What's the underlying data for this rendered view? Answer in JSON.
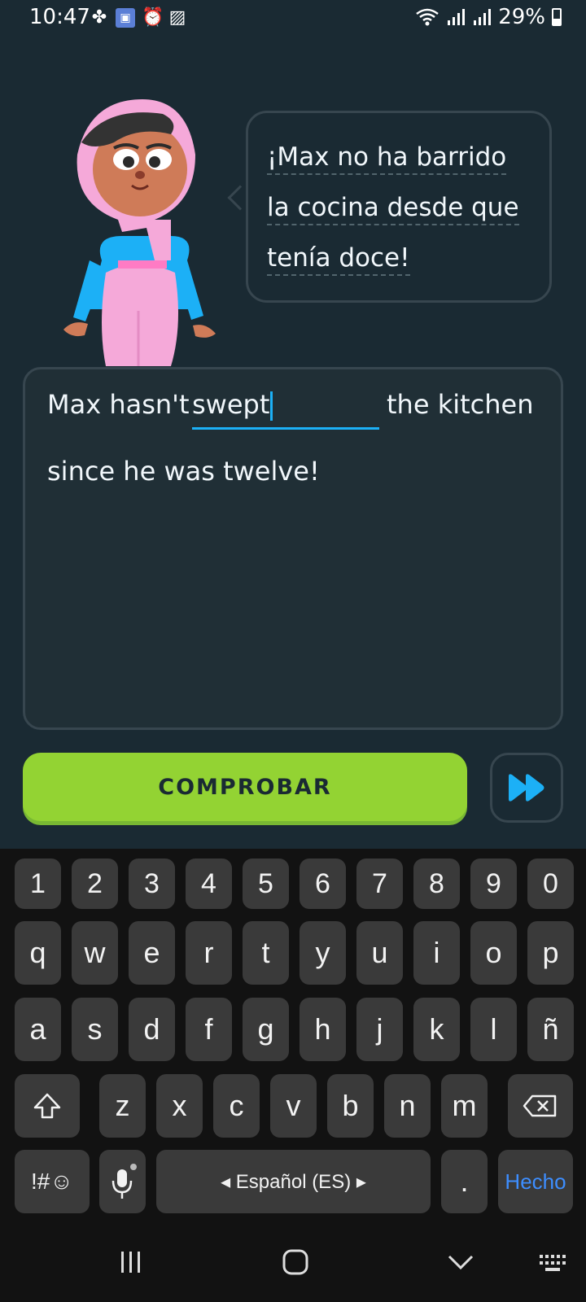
{
  "status_bar": {
    "time": "10:47",
    "battery": "29%",
    "icons": [
      "pinwheel-icon",
      "app-notification-icon",
      "alarm-icon",
      "image-icon",
      "wifi-icon",
      "signal-icon",
      "signal-icon",
      "battery-icon"
    ]
  },
  "prompt": {
    "lines": [
      "¡Max no ha barrido",
      "la cocina desde que",
      "tenía doce!"
    ]
  },
  "answer": {
    "before": "Max hasn't",
    "input_value": "swept",
    "after": "the kitchen",
    "line2": "since he was twelve!"
  },
  "buttons": {
    "check_label": "COMPROBAR",
    "skip_icon": "fast-forward-icon"
  },
  "keyboard": {
    "numbers": [
      "1",
      "2",
      "3",
      "4",
      "5",
      "6",
      "7",
      "8",
      "9",
      "0"
    ],
    "row1": [
      "q",
      "w",
      "e",
      "r",
      "t",
      "y",
      "u",
      "i",
      "o",
      "p"
    ],
    "row2": [
      "a",
      "s",
      "d",
      "f",
      "g",
      "h",
      "j",
      "k",
      "l",
      "ñ"
    ],
    "row3": [
      "z",
      "x",
      "c",
      "v",
      "b",
      "n",
      "m"
    ],
    "symbols_label": "!#☺",
    "space_label": "◂ Español (ES) ▸",
    "period_label": ".",
    "done_label": "Hecho"
  },
  "colors": {
    "background": "#1a2a33",
    "accent_green": "#93d333",
    "accent_blue": "#1cb0f6",
    "border": "#37464f"
  }
}
